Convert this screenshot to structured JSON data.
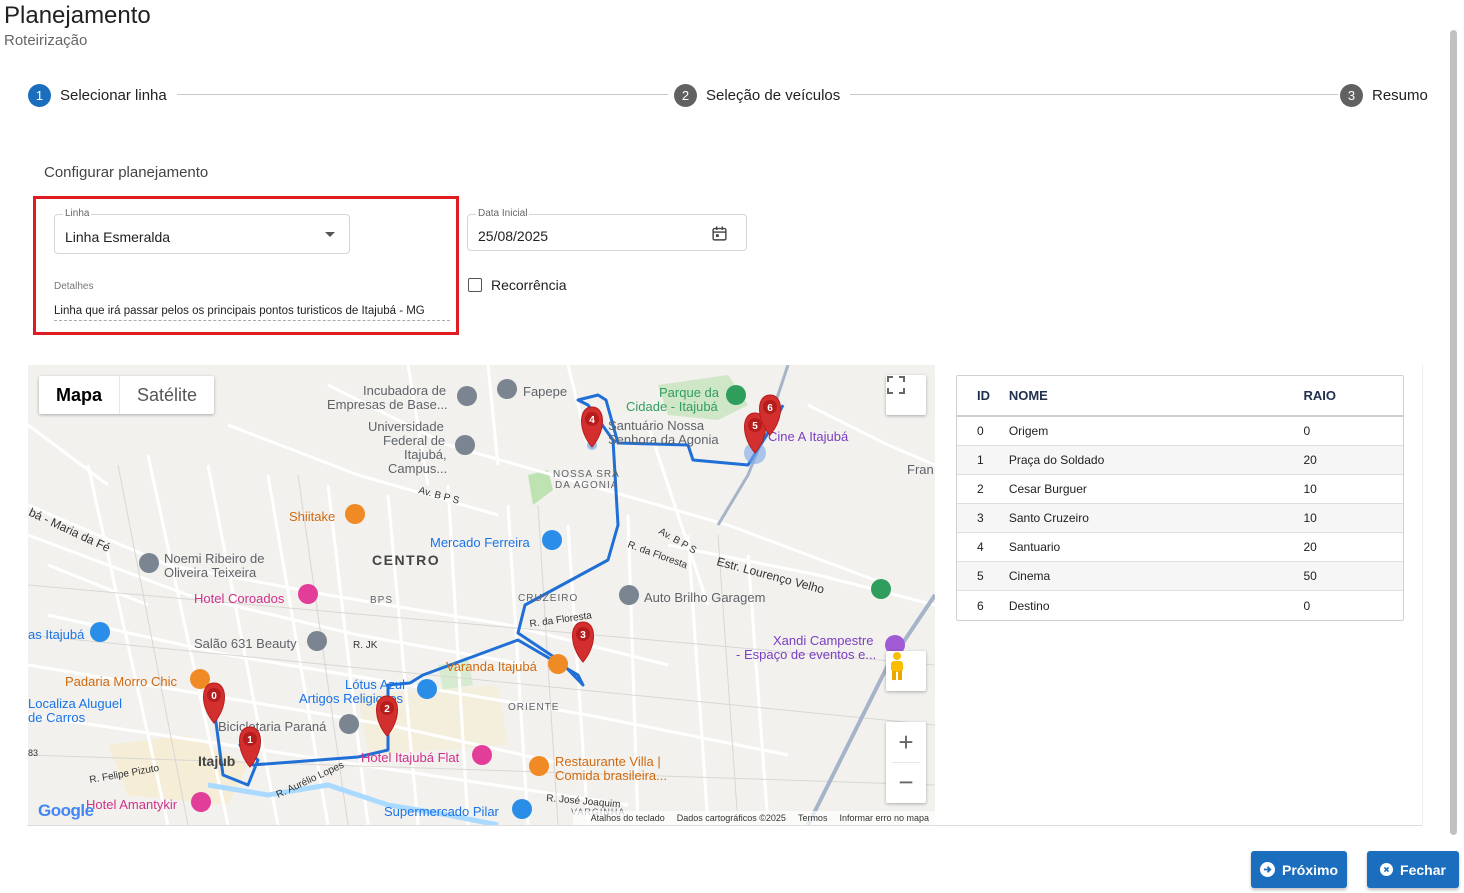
{
  "header": {
    "title": "Planejamento",
    "subtitle": "Roteirização"
  },
  "stepper": {
    "steps": [
      {
        "number": "1",
        "label": "Selecionar linha",
        "state": "active"
      },
      {
        "number": "2",
        "label": "Seleção de veículos",
        "state": "inactive"
      },
      {
        "number": "3",
        "label": "Resumo",
        "state": "inactive"
      }
    ],
    "active_color": "#1b6ebd",
    "inactive_color": "#616161"
  },
  "form": {
    "section_title": "Configurar planejamento",
    "linha": {
      "label": "Linha",
      "value": "Linha Esmeralda"
    },
    "detalhes": {
      "label": "Detalhes",
      "value": "Linha que irá passar pelos os principais pontos turisticos de Itajubá - MG"
    },
    "data_inicial": {
      "label": "Data Inicial",
      "value": "25/08/2025"
    },
    "recorrencia": {
      "label": "Recorrência",
      "checked": false
    },
    "highlight_color": "#e11b22"
  },
  "map": {
    "type_buttons": {
      "map": "Mapa",
      "satellite": "Satélite"
    },
    "zoom_in": "+",
    "zoom_out": "−",
    "logo": "Google",
    "footer": {
      "shortcuts": "Atalhos do teclado",
      "data": "Dados cartográficos ©2025",
      "terms": "Termos",
      "report": "Informar erro no mapa"
    },
    "labels": {
      "incubadora": "Incubadora de",
      "incubadora2": "Empresas de Base...",
      "fapepe": "Fapepe",
      "parque": "Parque da",
      "parque2": "Cidade - Itajubá",
      "santuario": "Santuário Nossa",
      "santuario2": "Senhora da Agonia",
      "cine": "Cine A Itajubá",
      "universidade": "Universidade",
      "universidade2": "Federal de",
      "universidade3": "Itajubá,",
      "universidade4": "Campus...",
      "nossa_sra": "NOSSA SRA",
      "da_agonia": "DA AGONIA",
      "fran": "Fran",
      "shiitake": "Shiitake",
      "av_bps": "Av. B P S",
      "estr": "Estr. Lourenço Velho",
      "maria": "bá - Maria da Fé",
      "noemi": "Noemi Ribeiro de",
      "noemi2": "Oliveira Teixeira",
      "centro": "CENTRO",
      "mercado": "Mercado Ferreira",
      "r_floresta": "R. da Floresta",
      "av_bps2": "Av. B P S",
      "hotel_coroados": "Hotel Coroados",
      "bps": "BPS",
      "cruzeiro": "CRUZEIRO",
      "auto_brilho": "Auto Brilho Garagem",
      "itajuba": "as Itajubá",
      "salao": "Salão 631 Beauty",
      "r_jk": "R. JK",
      "r_floresta2": "R. da Floresta",
      "xandi": "Xandi Campestre",
      "xandi2": "- Espaço de eventos e...",
      "padaria": "Padaria Morro Chic",
      "lotus": "Lótus Azul",
      "artigos": "Artigos Religiosos",
      "varanda": "Varanda Itajubá",
      "localiza": "Localiza Aluguel",
      "localiza2": "de Carros",
      "oriente": "ORIENTE",
      "bicicletaria": "Bicicletaria Paraná",
      "itajub": "Itajub",
      "hotel_flat": "Hotel Itajubá Flat",
      "r_felipe": "R. Felipe Pizuto",
      "r_aurelio": "R. Aurélio Lopes",
      "restaurante": "Restaurante Villa |",
      "restaurante2": "Comida brasileira...",
      "hotel_amantykir": "Hotel Amantykir",
      "r_jose": "R. José Joaquim",
      "supermercado": "Supermercado Pilar",
      "vargem": "VARGINHA",
      "route_83": "83"
    },
    "markers": [
      "0",
      "1",
      "2",
      "3",
      "4",
      "5",
      "6"
    ]
  },
  "table": {
    "headers": {
      "id": "ID",
      "nome": "NOME",
      "raio": "RAIO"
    },
    "rows": [
      {
        "id": "0",
        "nome": "Origem",
        "raio": "0"
      },
      {
        "id": "1",
        "nome": "Praça do Soldado",
        "raio": "20"
      },
      {
        "id": "2",
        "nome": "Cesar Burguer",
        "raio": "10"
      },
      {
        "id": "3",
        "nome": "Santo Cruzeiro",
        "raio": "10"
      },
      {
        "id": "4",
        "nome": "Santuario",
        "raio": "20"
      },
      {
        "id": "5",
        "nome": "Cinema",
        "raio": "50"
      },
      {
        "id": "6",
        "nome": "Destino",
        "raio": "0"
      }
    ]
  },
  "actions": {
    "next": "Próximo",
    "close": "Fechar"
  }
}
